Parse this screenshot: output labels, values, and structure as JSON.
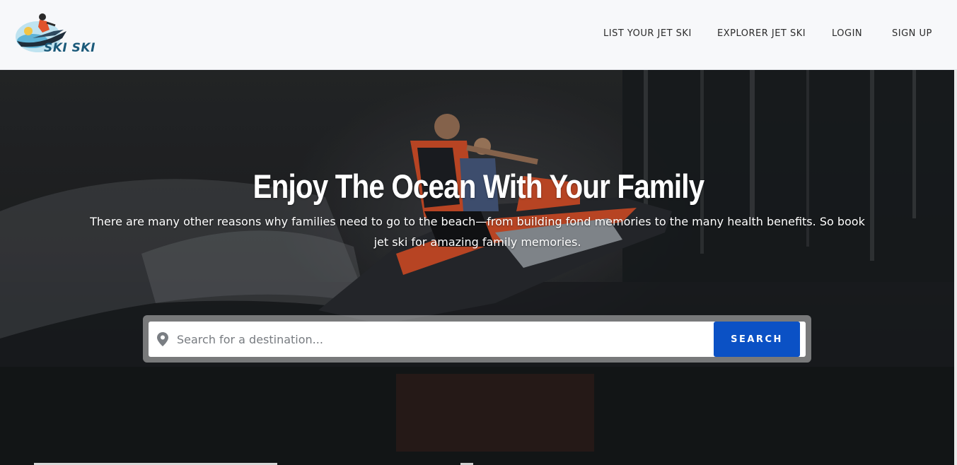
{
  "logo": {
    "text": "SKI SKI",
    "icon": "jet-ski-logo"
  },
  "nav": {
    "items": [
      {
        "label": "LIST YOUR JET SKI"
      },
      {
        "label": "EXPLORER JET SKI"
      },
      {
        "label": "LOGIN"
      },
      {
        "label": "SIGN UP"
      }
    ]
  },
  "hero": {
    "title": "Enjoy The Ocean With Your Family",
    "subtitle": "There are many other reasons why families need to go to the beach—from building fond memories to the many health benefits. So book jet ski for amazing family memories."
  },
  "search": {
    "placeholder": "Search for a destination...",
    "value": "",
    "icon": "map-pin-icon",
    "button_label": "SEARCH"
  },
  "colors": {
    "accent": "#0b51c5",
    "header_bg": "#f7f8fa",
    "logo_text": "#1b5a7a",
    "jet_ski_orange": "#e0532b"
  }
}
